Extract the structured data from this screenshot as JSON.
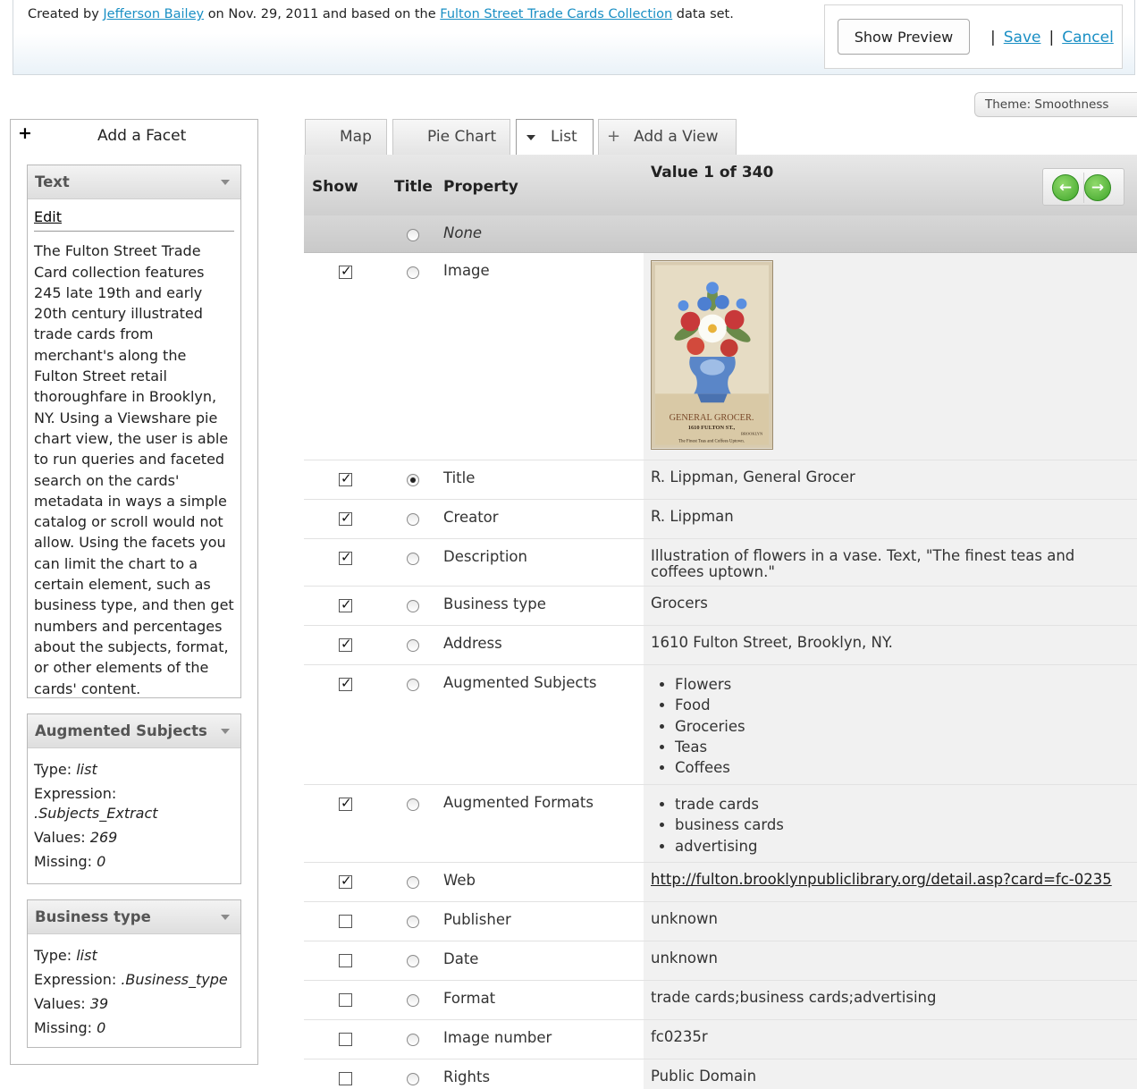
{
  "header": {
    "created_prefix": "Created by",
    "author": "Jefferson Bailey",
    "created_middle": "on Nov. 29, 2011 and based on the",
    "dataset": "Fulton Street Trade Cards Collection",
    "created_suffix": "data set.",
    "show_preview": "Show Preview",
    "save": "Save",
    "cancel": "Cancel",
    "separator": "|"
  },
  "theme": {
    "label": "Theme: Smoothness"
  },
  "sidebar": {
    "add_facet": "Add a Facet",
    "text_facet": {
      "title": "Text",
      "edit": "Edit",
      "body": "The Fulton Street Trade Card collection features 245 late 19th and early 20th century illustrated trade cards from merchant's along the Fulton Street retail thoroughfare in Brooklyn, NY. Using a Viewshare pie chart view, the user is able to run queries and faceted search on the cards' metadata in ways a simple catalog or scroll would not allow. Using the facets you can limit the chart to a certain element, such as business type, and then get numbers and percentages about the subjects, format, or other elements of the cards' content."
    },
    "subjects_facet": {
      "title": "Augmented Subjects",
      "type_label": "Type:",
      "type_value": "list",
      "expression_label": "Expression:",
      "expression_value": ".Subjects_Extract",
      "values_label": "Values:",
      "values_value": "269",
      "missing_label": "Missing:",
      "missing_value": "0"
    },
    "business_facet": {
      "title": "Business type",
      "type_label": "Type:",
      "type_value": "list",
      "expression_label": "Expression:",
      "expression_value": ".Business_type",
      "values_label": "Values:",
      "values_value": "39",
      "missing_label": "Missing:",
      "missing_value": "0"
    }
  },
  "tabs": {
    "map": "Map",
    "pie_chart": "Pie Chart",
    "list": "List",
    "add_view": "Add a View",
    "plus": "+"
  },
  "table": {
    "headers": {
      "show": "Show",
      "title": "Title",
      "property": "Property"
    },
    "value_count": "Value 1 of 340",
    "none_label": "None",
    "nav": {
      "prev": "←",
      "next": "→"
    },
    "rows": [
      {
        "property": "Image",
        "value": ""
      },
      {
        "property": "Title",
        "value": "R. Lippman, General Grocer"
      },
      {
        "property": "Creator",
        "value": "R. Lippman"
      },
      {
        "property": "Description",
        "value": "Illustration of flowers in a vase. Text, \"The finest teas and coffees uptown.\""
      },
      {
        "property": "Business type",
        "value": "Grocers"
      },
      {
        "property": "Address",
        "value": "1610 Fulton Street, Brooklyn, NY."
      },
      {
        "property": "Augmented Subjects",
        "list": [
          "Flowers",
          "Food",
          "Groceries",
          "Teas",
          "Coffees"
        ]
      },
      {
        "property": "Augmented Formats",
        "list": [
          "trade cards",
          "business cards",
          "advertising"
        ]
      },
      {
        "property": "Web",
        "value": "http://fulton.brooklynpubliclibrary.org/detail.asp?card=fc-0235"
      },
      {
        "property": "Publisher",
        "value": "unknown"
      },
      {
        "property": "Date",
        "value": "unknown"
      },
      {
        "property": "Format",
        "value": "trade cards;business cards;advertising"
      },
      {
        "property": "Image number",
        "value": "fc0235r"
      },
      {
        "property": "Rights",
        "value": "Public Domain"
      }
    ]
  },
  "card_image": {
    "line1": "GENERAL GROCER.",
    "line2": "1610 FULTON ST.,",
    "line3": "BROOKLYN",
    "line4": "The Finest Teas and Coffees Uptown."
  }
}
